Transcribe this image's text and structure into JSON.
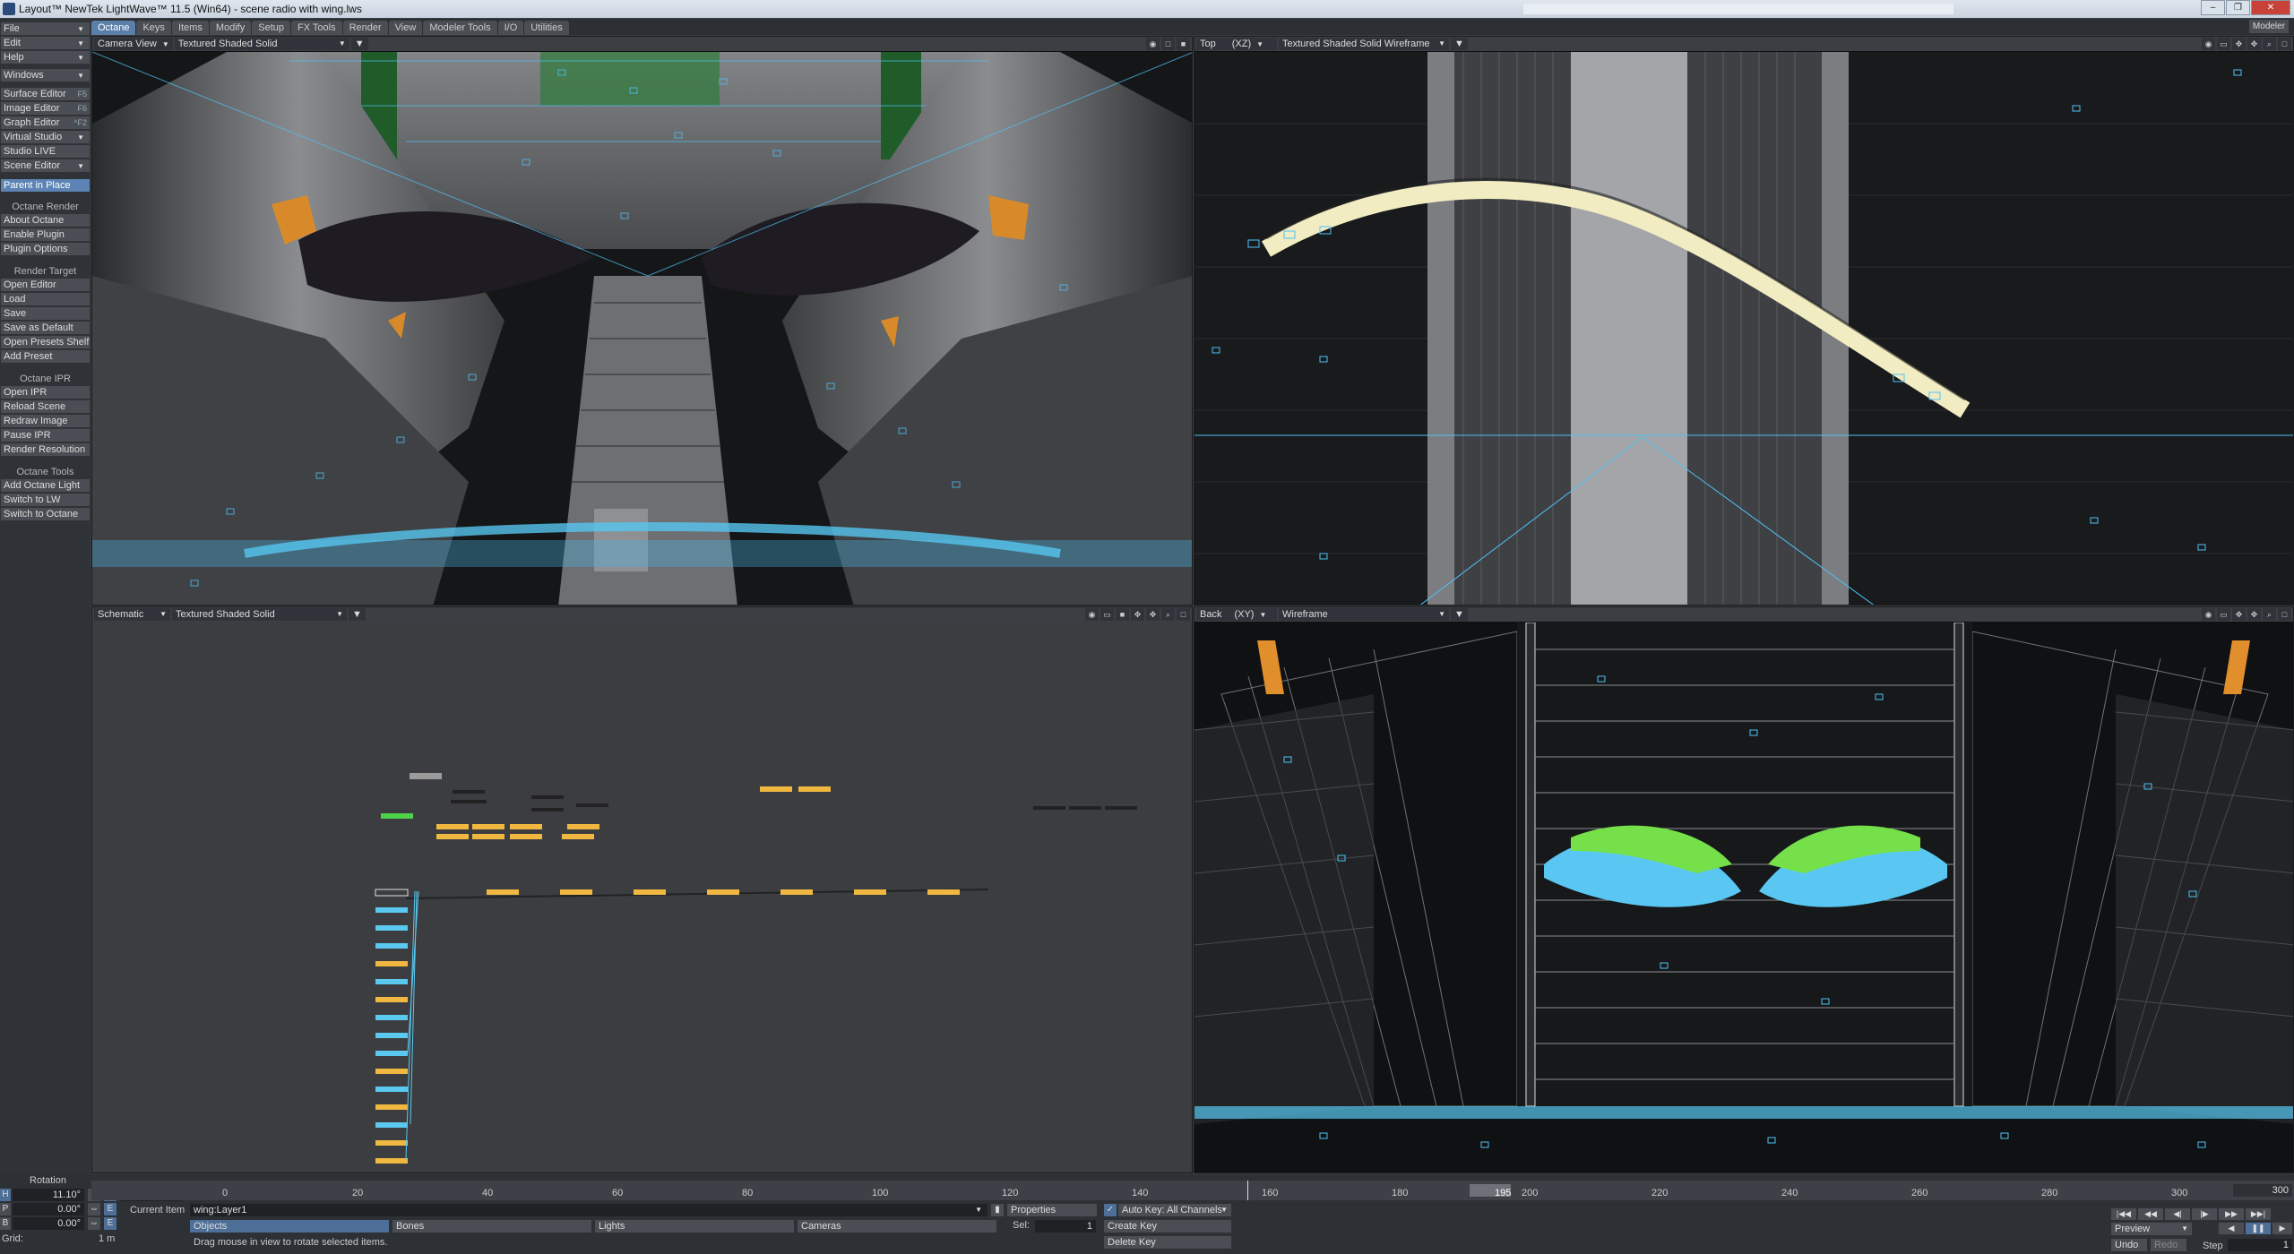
{
  "window": {
    "title": "Layout™ NewTek LightWave™ 11.5 (Win64) - scene radio with wing.lws"
  },
  "tabs": [
    "Octane",
    "Keys",
    "Items",
    "Modify",
    "Setup",
    "FX Tools",
    "Render",
    "View",
    "Modeler Tools",
    "I/O",
    "Utilities"
  ],
  "modeler_button": "Modeler",
  "sidebar": {
    "top": [
      {
        "label": "File"
      },
      {
        "label": "Edit"
      },
      {
        "label": "Help"
      }
    ],
    "windows": "Windows",
    "editors": [
      {
        "label": "Surface Editor",
        "key": "F5"
      },
      {
        "label": "Image Editor",
        "key": "F6"
      },
      {
        "label": "Graph Editor",
        "key": "^F2"
      },
      {
        "label": "Virtual Studio"
      },
      {
        "label": "Studio LIVE"
      },
      {
        "label": "Scene Editor"
      }
    ],
    "parent_in_place": "Parent in Place",
    "sections": [
      {
        "header": "Octane Render",
        "items": [
          "About Octane",
          "Enable Plugin",
          "Plugin Options"
        ]
      },
      {
        "header": "Render Target",
        "items": [
          "Open Editor",
          "Load",
          "Save",
          "Save as Default",
          "Open Presets Shelf",
          "Add Preset"
        ]
      },
      {
        "header": "Octane IPR",
        "items": [
          "Open IPR",
          "Reload Scene",
          "Redraw Image",
          "Pause IPR",
          "Render Resolution"
        ]
      },
      {
        "header": "Octane Tools",
        "items": [
          "Add Octane Light",
          "Switch to LW",
          "Switch to Octane"
        ]
      }
    ]
  },
  "viewports": {
    "tl": {
      "view": "Camera View",
      "mode": "Textured Shaded Solid"
    },
    "tr": {
      "view": "Top",
      "axis": "(XZ)",
      "mode": "Textured Shaded Solid Wireframe"
    },
    "bl": {
      "view": "Schematic",
      "mode": "Textured Shaded Solid"
    },
    "br": {
      "view": "Back",
      "axis": "(XY)",
      "mode": "Wireframe"
    }
  },
  "timeline": {
    "ticks": [
      "0",
      "20",
      "40",
      "60",
      "80",
      "100",
      "120",
      "140",
      "160",
      "180",
      "195",
      "200",
      "220",
      "240",
      "260",
      "280",
      "300"
    ],
    "current_frame": "195",
    "start_frame": "0",
    "end_frame": "300",
    "rotation_label": "Rotation",
    "h_label": "H",
    "h_value": "11.10°",
    "p_label": "P",
    "p_value": "0.00°",
    "b_label": "B",
    "b_value": "0.00°",
    "grid_label": "Grid:",
    "grid_value": "1 m",
    "current_item_label": "Current Item",
    "current_item_value": "wing:Layer1",
    "objects": "Objects",
    "bones": "Bones",
    "lights": "Lights",
    "cameras": "Cameras",
    "properties": "Properties",
    "sel_label": "Sel:",
    "sel_value": "1",
    "auto_key": "Auto Key: All Channels",
    "create_key": "Create Key",
    "delete_key": "Delete Key",
    "preview": "Preview",
    "step_label": "Step",
    "step_value": "1",
    "undo": "Undo",
    "redo": "Redo",
    "status": "Drag mouse in view to rotate selected items."
  }
}
